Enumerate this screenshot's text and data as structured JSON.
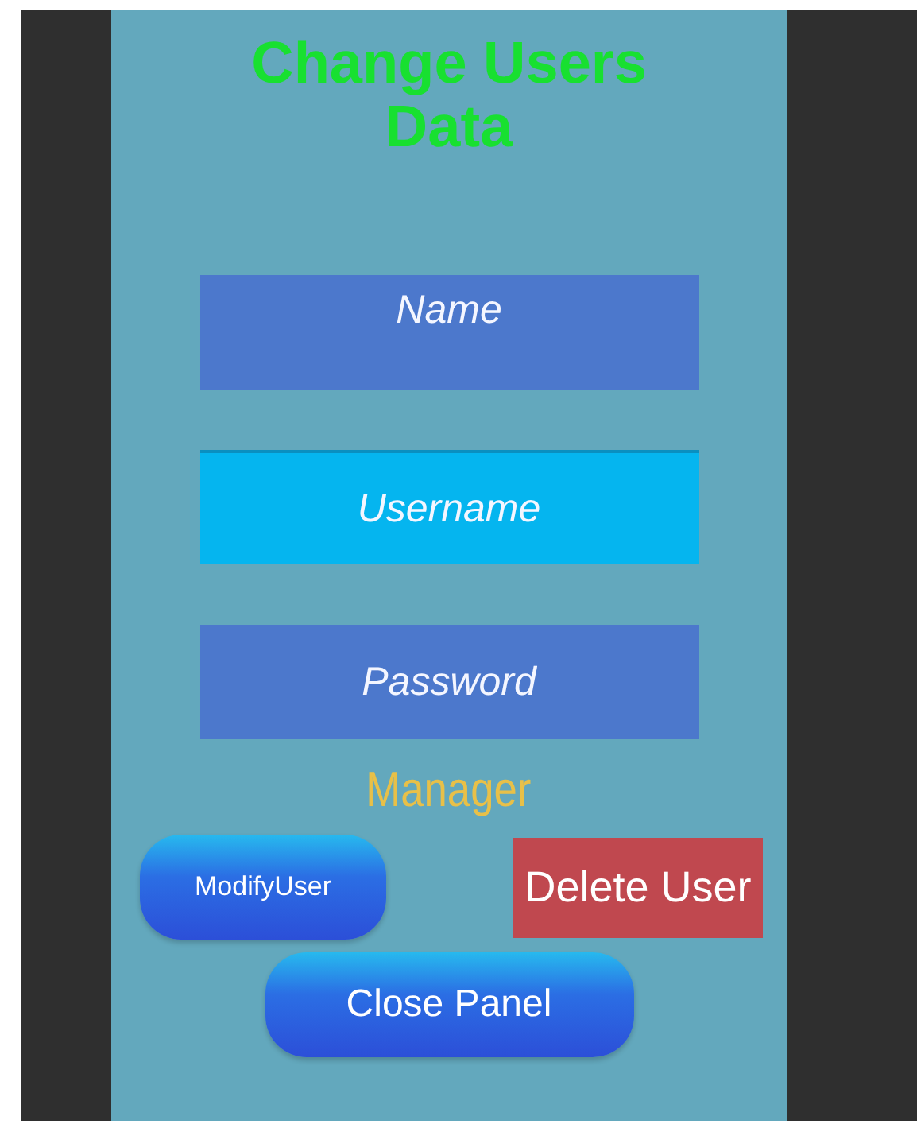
{
  "title": "Change Users Data",
  "fields": [
    {
      "placeholder": "Name",
      "focused": false
    },
    {
      "placeholder": "Username",
      "focused": true
    },
    {
      "placeholder": "Password",
      "focused": false
    }
  ],
  "role": "Manager",
  "buttons": [
    {
      "label": "ModifyUser",
      "kind": "pill"
    },
    {
      "label": "Delete User",
      "kind": "danger"
    },
    {
      "label": "Close Panel",
      "kind": "pill-large"
    }
  ]
}
